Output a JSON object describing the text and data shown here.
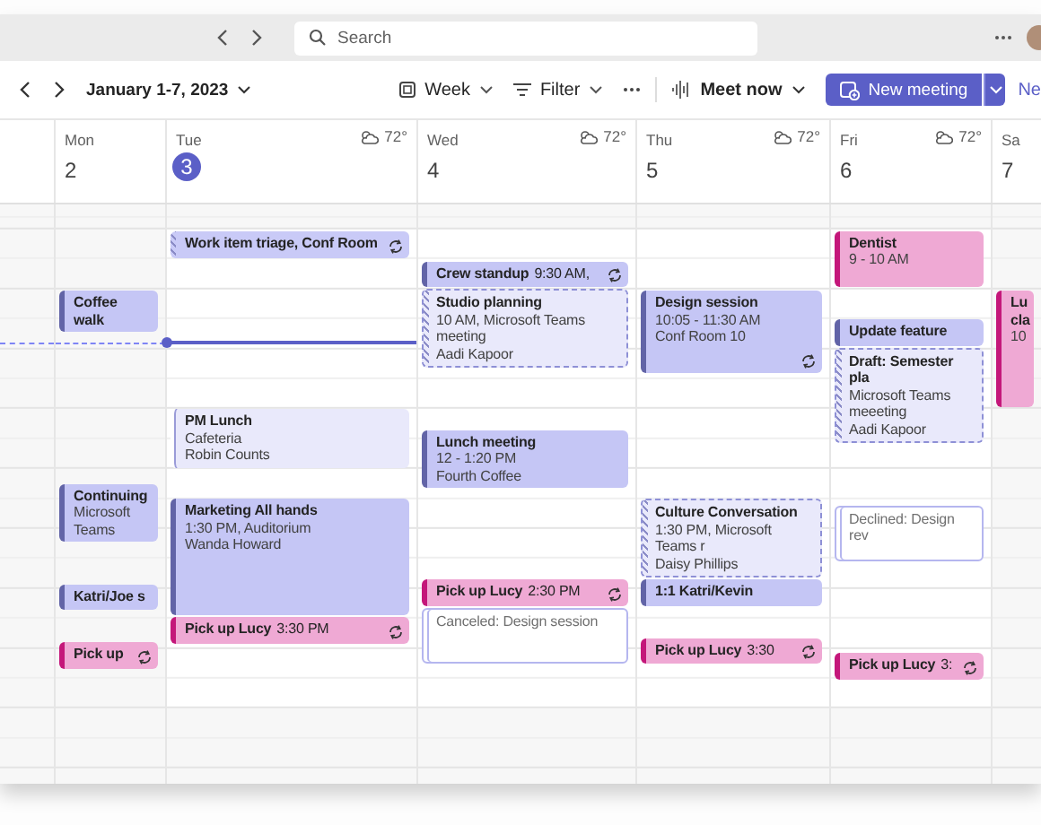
{
  "titlebar": {
    "search": {
      "placeholder": "Search"
    }
  },
  "toolbar": {
    "date_range": "January 1-7, 2023",
    "view": "Week",
    "filter": "Filter",
    "meet_now": "Meet now",
    "new_meeting": "New meeting",
    "cut_label": "Ne"
  },
  "days": [
    {
      "name": "Mon",
      "date": "2",
      "today": false,
      "working_day": false,
      "events": [
        {
          "kind": "busy",
          "title": "Coffee walk",
          "recurring": false
        },
        {
          "kind": "busy",
          "title": "Continuing",
          "details": [
            "Microsoft Teams"
          ],
          "recurring": false
        },
        {
          "kind": "busy",
          "title": "Katri/Joe s",
          "recurring": false
        },
        {
          "kind": "personal",
          "title": "Pick up",
          "recurring": true
        }
      ]
    },
    {
      "name": "Tue",
      "date": "3",
      "today": true,
      "working_day": true,
      "weather": "72°",
      "events": [
        {
          "kind": "pending",
          "title": "Work item triage, Conf Room",
          "recurring": true
        },
        {
          "kind": "light",
          "title": "PM Lunch",
          "details": [
            "Cafeteria",
            "Robin Counts"
          ],
          "recurring": false
        },
        {
          "kind": "busy",
          "title": "Marketing All hands",
          "details": [
            "1:30 PM, Auditorium",
            "Wanda Howard"
          ],
          "recurring": false
        },
        {
          "kind": "personal",
          "title": "Pick up Lucy",
          "note": "3:30 PM",
          "recurring": true
        }
      ]
    },
    {
      "name": "Wed",
      "date": "4",
      "today": false,
      "working_day": true,
      "weather": "72°",
      "events": [
        {
          "kind": "busy",
          "title": "Crew standup",
          "note": "9:30 AM,",
          "recurring": true
        },
        {
          "kind": "tentative",
          "title": "Studio planning",
          "details": [
            "10 AM, Microsoft Teams meeting",
            "Aadi Kapoor"
          ],
          "recurring": false
        },
        {
          "kind": "busy",
          "title": "Lunch meeting",
          "details": [
            "12 - 1:20 PM",
            "Fourth Coffee"
          ],
          "recurring": false
        },
        {
          "kind": "personal",
          "title": "Pick up Lucy",
          "note": "2:30 PM",
          "recurring": true
        },
        {
          "kind": "declined",
          "title": "Canceled: Design session",
          "recurring": false
        }
      ]
    },
    {
      "name": "Thu",
      "date": "5",
      "today": false,
      "working_day": true,
      "weather": "72°",
      "events": [
        {
          "kind": "busy",
          "title": "Design session",
          "details": [
            "10:05 - 11:30 AM",
            "Conf Room 10"
          ],
          "recurring": true
        },
        {
          "kind": "tentative",
          "title": "Culture Conversation",
          "details": [
            "1:30 PM, Microsoft Teams r",
            "Daisy Phillips"
          ],
          "recurring": false
        },
        {
          "kind": "busy",
          "title": "1:1 Katri/Kevin",
          "recurring": false
        },
        {
          "kind": "personal",
          "title": "Pick up Lucy",
          "note": "3:30",
          "recurring": true
        }
      ]
    },
    {
      "name": "Fri",
      "date": "6",
      "today": false,
      "working_day": true,
      "weather": "72°",
      "events": [
        {
          "kind": "personal",
          "title": "Dentist",
          "details": [
            "9 - 10 AM"
          ],
          "recurring": false
        },
        {
          "kind": "busy",
          "title": "Update feature",
          "recurring": false
        },
        {
          "kind": "tentative",
          "title": "Draft: Semester pla",
          "details": [
            "Microsoft Teams meeeting",
            "Aadi Kapoor"
          ],
          "recurring": false
        },
        {
          "kind": "declined",
          "title": "Declined: Design rev",
          "recurring": false
        },
        {
          "kind": "personal",
          "title": "Pick up Lucy",
          "note": "3:",
          "recurring": true
        }
      ]
    },
    {
      "name": "Sa",
      "date": "7",
      "today": false,
      "working_day": false,
      "events": [
        {
          "kind": "personal",
          "title": "Lu cla",
          "details": [
            "10"
          ],
          "recurring": false
        }
      ]
    }
  ]
}
